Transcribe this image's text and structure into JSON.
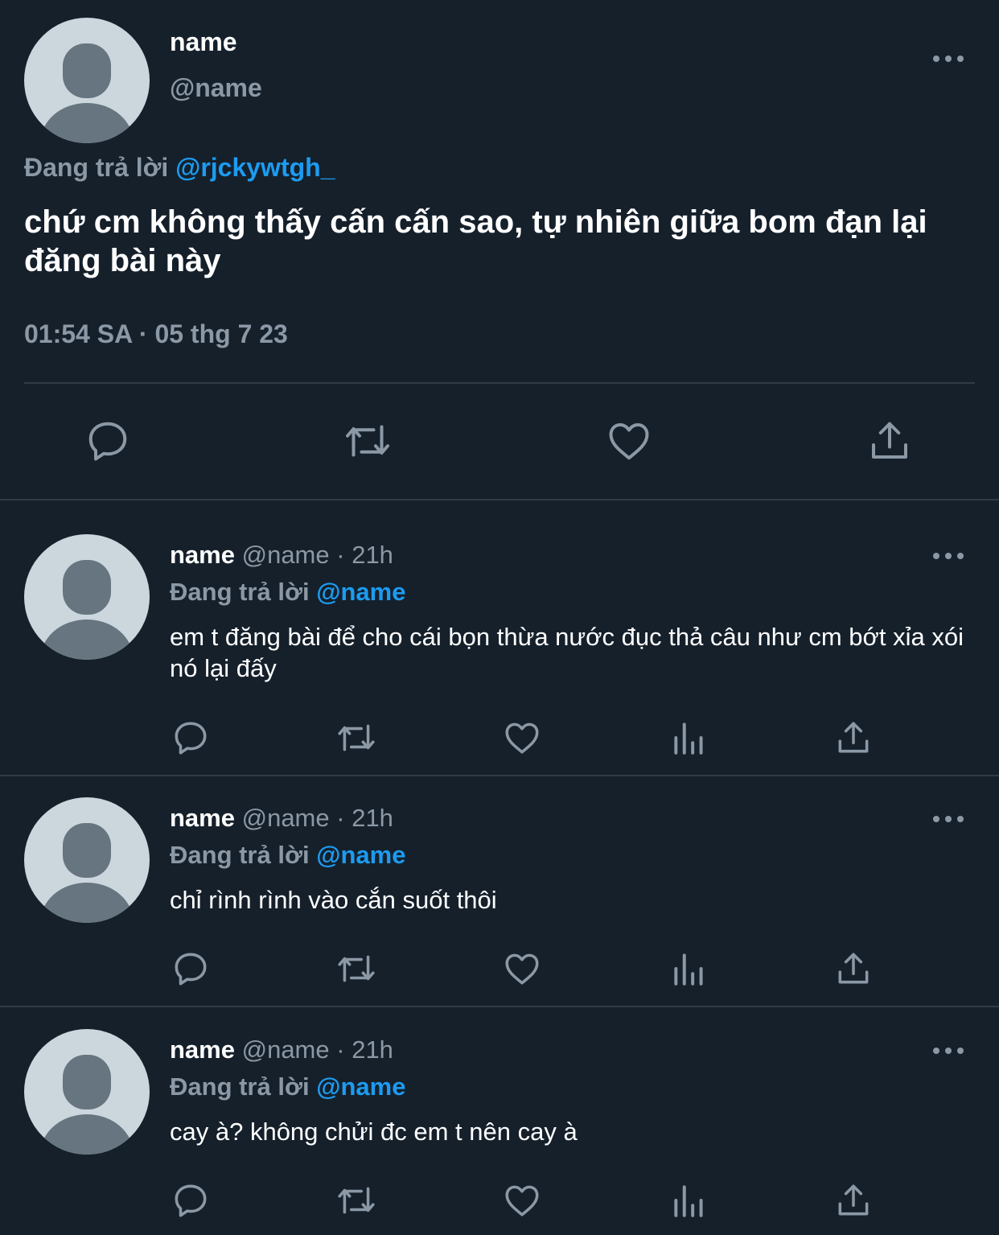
{
  "main_tweet": {
    "display_name": "name",
    "handle": "@name",
    "replying_prefix": "Đang trả lời",
    "replying_to": "@rjckywtgh_",
    "text": "chứ cm không thấy cấn cấn sao, tự nhiên giữa bom đạn lại đăng bài này",
    "timestamp": "01:54 SA · 05 thg 7 23",
    "actions": [
      "reply-icon",
      "retweet-icon",
      "like-icon",
      "share-icon"
    ]
  },
  "replies": [
    {
      "display_name": "name",
      "handle": "@name",
      "separator": "·",
      "time": "21h",
      "replying_prefix": "Đang trả lời",
      "replying_to": "@name",
      "text": "em t đăng bài để cho cái bọn thừa nước đục thả câu như cm bớt xỉa xói nó lại đấy"
    },
    {
      "display_name": "name",
      "handle": "@name",
      "separator": "·",
      "time": "21h",
      "replying_prefix": "Đang trả lời",
      "replying_to": "@name",
      "text": "chỉ rình rình vào cắn suốt thôi"
    },
    {
      "display_name": "name",
      "handle": "@name",
      "separator": "·",
      "time": "21h",
      "replying_prefix": "Đang trả lời",
      "replying_to": "@name",
      "text": "cay à? không chửi đc em t nên cay à"
    }
  ],
  "reply_actions": [
    "reply-icon",
    "retweet-icon",
    "like-icon",
    "analytics-icon",
    "share-icon"
  ],
  "colors": {
    "background": "#15202b",
    "primary_text": "#ffffff",
    "secondary_text": "#8b98a5",
    "accent": "#1d9bf0",
    "divider": "#2f3b47",
    "avatar_bg": "#ccd6dd",
    "avatar_fg": "#66757f"
  }
}
